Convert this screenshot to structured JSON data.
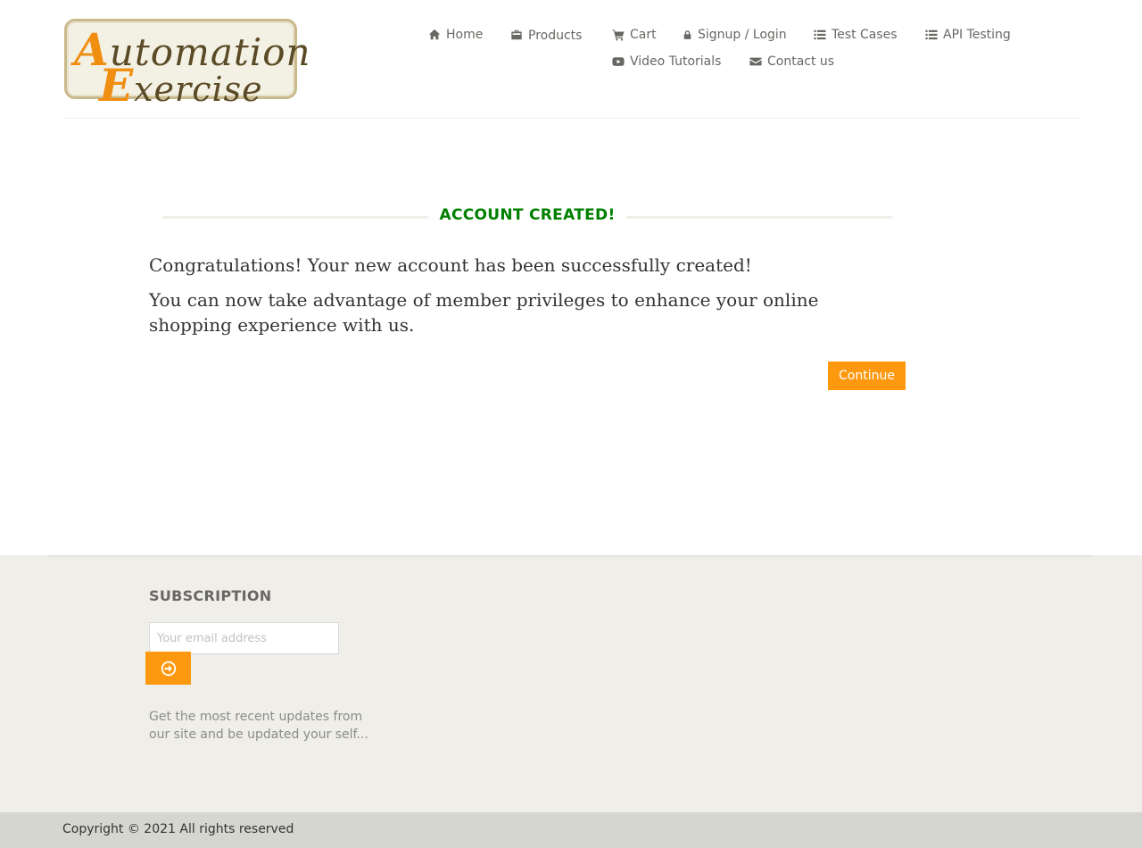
{
  "logo": {
    "line1_first": "A",
    "line1_rest": "utomation",
    "line2_first": "E",
    "line2_rest": "xercise"
  },
  "nav": {
    "home": {
      "label": "Home",
      "icon": "home-icon"
    },
    "products": {
      "label": "Products",
      "icon": "briefcase-icon"
    },
    "cart": {
      "label": "Cart",
      "icon": "cart-icon"
    },
    "login": {
      "label": "Signup / Login",
      "icon": "lock-icon"
    },
    "test_cases": {
      "label": "Test Cases",
      "icon": "list-icon"
    },
    "api_testing": {
      "label": "API Testing",
      "icon": "list-icon"
    },
    "video": {
      "label": "Video Tutorials",
      "icon": "youtube-icon"
    },
    "contact": {
      "label": "Contact us",
      "icon": "envelope-icon"
    }
  },
  "main": {
    "title": "ACCOUNT CREATED!",
    "message1": "Congratulations! Your new account has been successfully created!",
    "message2": "You can now take advantage of member privileges to enhance your online shopping experience with us.",
    "continue_label": "Continue"
  },
  "footer": {
    "subscription_title": "SUBSCRIPTION",
    "email_placeholder": "Your email address",
    "subscribe_icon": "arrow-circle-right-icon",
    "description": "Get the most recent updates from our site and be updated your self...",
    "copyright": "Copyright © 2021 All rights reserved"
  },
  "colors": {
    "accent": "#fe980f",
    "success": "#008000",
    "footer_bg": "#efeee9",
    "copyright_bg": "#d6d6d0"
  }
}
